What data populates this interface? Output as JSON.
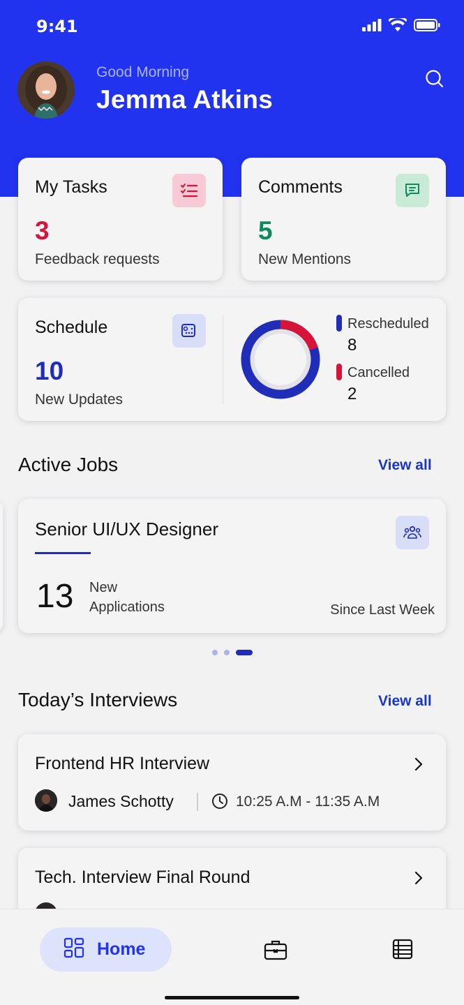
{
  "status_bar": {
    "time": "9:41"
  },
  "header": {
    "greeting": "Good Morning",
    "user_name": "Jemma Atkins"
  },
  "cards": {
    "tasks": {
      "title": "My Tasks",
      "count": "3",
      "subtitle": "Feedback requests",
      "color": "#d6143a"
    },
    "comments": {
      "title": "Comments",
      "count": "5",
      "subtitle": "New Mentions",
      "color": "#0e8a5f"
    },
    "schedule": {
      "title": "Schedule",
      "count": "10",
      "subtitle": "New Updates",
      "legend": [
        {
          "label": "Rescheduled",
          "value": "8",
          "color": "#1f2db8"
        },
        {
          "label": "Cancelled",
          "value": "2",
          "color": "#d6143a"
        }
      ]
    }
  },
  "active_jobs": {
    "heading": "Active Jobs",
    "view_all": "View all",
    "job": {
      "title": "Senior UI/UX Designer",
      "count": "13",
      "label_line1": "New",
      "label_line2": "Applications",
      "period": "Since Last Week"
    },
    "pager": {
      "pages": 3,
      "active": 3
    }
  },
  "interviews": {
    "heading": "Today’s Interviews",
    "view_all": "View all",
    "items": [
      {
        "title": "Frontend HR Interview",
        "person": "James Schotty",
        "time": "10:25 A.M - 11:35 A.M"
      },
      {
        "title": "Tech. Interview Final Round"
      }
    ]
  },
  "tab_bar": {
    "home_label": "Home",
    "accent": "#2233f0"
  }
}
